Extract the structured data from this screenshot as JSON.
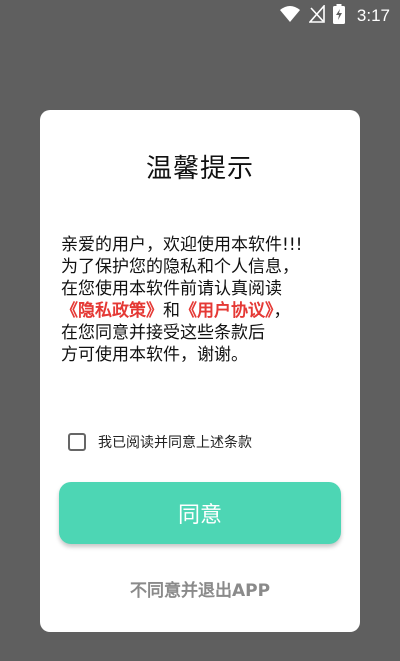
{
  "status_bar": {
    "time": "3:17",
    "icons": [
      "wifi-icon",
      "no-sim-icon",
      "battery-charging-icon"
    ]
  },
  "dialog": {
    "title": "温馨提示",
    "message": {
      "line1": "亲爱的用户，欢迎使用本软件!!!",
      "line2": "为了保护您的隐私和个人信息，",
      "line3": "在您使用本软件前请认真阅读",
      "privacy_link": "《隐私政策》",
      "and": "和",
      "user_agreement_link": "《用户协议》",
      "line4_end": "，",
      "line5": "在您同意并接受这些条款后",
      "line6": "方可使用本软件，谢谢。"
    },
    "checkbox": {
      "label": "我已阅读并同意上述条款",
      "checked": false
    },
    "agree_button": "同意",
    "exit_link": "不同意并退出APP"
  },
  "colors": {
    "background": "#5f5f5f",
    "dialog": "#ffffff",
    "link": "#e53935",
    "button": "#4dd6b4",
    "exit_text": "#8a8a8a"
  }
}
